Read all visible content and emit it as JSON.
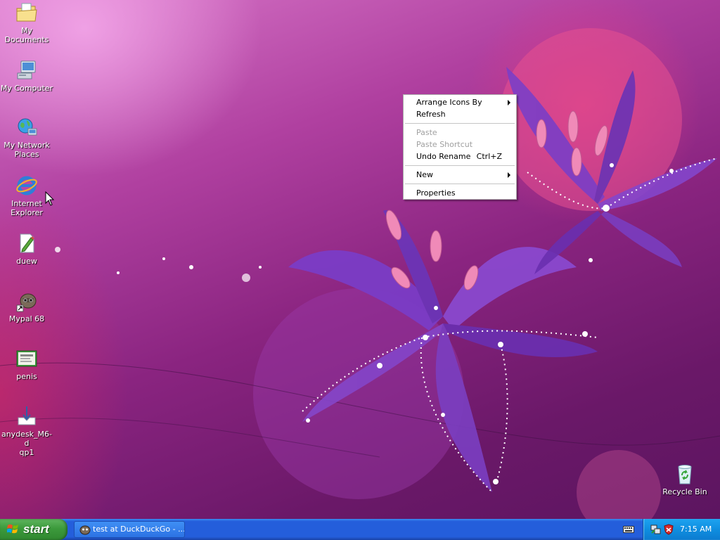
{
  "desktop": {
    "icons": [
      {
        "label": "My Documents",
        "icon": "folder-documents-icon"
      },
      {
        "label": "My Computer",
        "icon": "computer-icon"
      },
      {
        "label_line1": "My Network",
        "label_line2": "Places",
        "icon": "network-places-icon"
      },
      {
        "label_line1": "Internet",
        "label_line2": "Explorer",
        "icon": "internet-explorer-icon"
      },
      {
        "label": "duew",
        "icon": "document-edit-icon"
      },
      {
        "label": "Mypal 68",
        "icon": "mypal-shortcut-icon"
      },
      {
        "label": "penis",
        "icon": "certificate-image-icon"
      },
      {
        "label_line1": "anydesk_M6-d",
        "label_line2": "qp1",
        "icon": "download-file-icon"
      },
      {
        "label": "Recycle Bin",
        "icon": "recycle-bin-icon"
      }
    ]
  },
  "context_menu": {
    "items": [
      {
        "label": "Arrange Icons By",
        "submenu": true
      },
      {
        "label": "Refresh"
      },
      {
        "label": "Paste",
        "disabled": true
      },
      {
        "label": "Paste Shortcut",
        "disabled": true
      },
      {
        "label": "Undo Rename",
        "shortcut": "Ctrl+Z"
      },
      {
        "label": "New",
        "submenu": true
      },
      {
        "label": "Properties"
      }
    ]
  },
  "taskbar": {
    "start_label": "start",
    "task_button_label": "test at DuckDuckGo - ...",
    "clock": "7:15 AM"
  },
  "colors": {
    "taskbar_blue": "#245edb",
    "start_green": "#3c9a3c",
    "tray_blue": "#0f8ee0"
  }
}
